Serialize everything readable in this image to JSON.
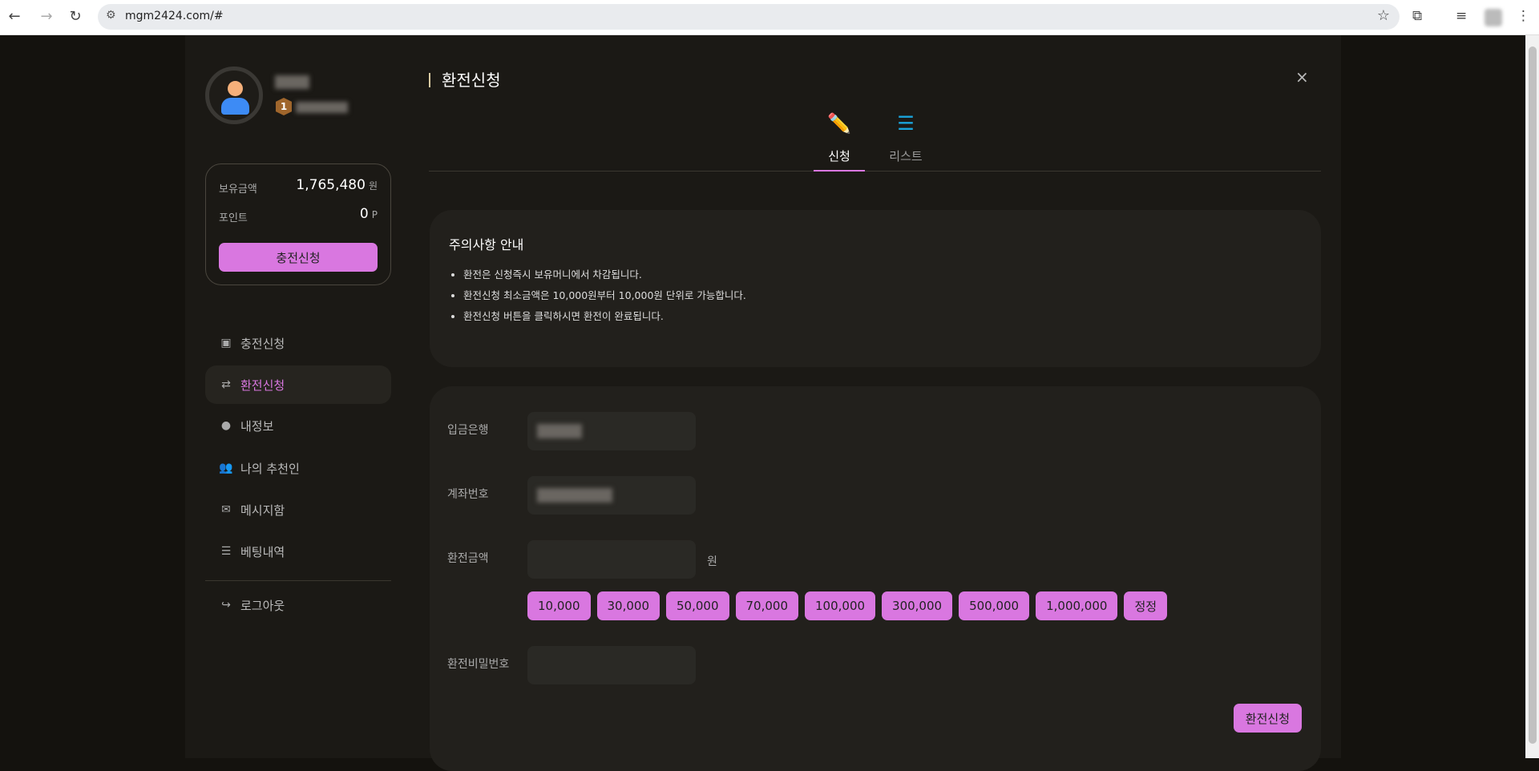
{
  "browser": {
    "url": "mgm2424.com/#"
  },
  "sidebar": {
    "balance_label": "보유금액",
    "balance_value": "1,765,480",
    "balance_unit": "원",
    "point_label": "포인트",
    "point_value": "0",
    "point_unit": "P",
    "charge_button": "충전신청",
    "level": "1",
    "menu": [
      {
        "label": "충전신청",
        "icon": "money-icon"
      },
      {
        "label": "환전신청",
        "icon": "exchange-icon"
      },
      {
        "label": "내정보",
        "icon": "user-circle-icon"
      },
      {
        "label": "나의 추천인",
        "icon": "users-icon"
      },
      {
        "label": "메시지함",
        "icon": "envelope-open-icon"
      },
      {
        "label": "베팅내역",
        "icon": "list-icon"
      }
    ],
    "logout": "로그아웃"
  },
  "main": {
    "title": "환전신청",
    "close": "×",
    "tabs": [
      {
        "label": "신청",
        "icon": "pencil-icon"
      },
      {
        "label": "리스트",
        "icon": "list-icon"
      }
    ],
    "notice": {
      "title": "주의사항 안내",
      "items": [
        "환전은 신청즉시 보유머니에서 차감됩니다.",
        "환전신청 최소금액은 10,000원부터 10,000원 단위로 가능합니다.",
        "환전신청 버튼을 클릭하시면 환전이 완료됩니다."
      ]
    },
    "form": {
      "bank_label": "입금은행",
      "account_label": "계좌번호",
      "amount_label": "환전금액",
      "amount_unit": "원",
      "password_label": "환전비밀번호",
      "amounts": [
        "10,000",
        "30,000",
        "50,000",
        "70,000",
        "100,000",
        "300,000",
        "500,000",
        "1,000,000",
        "정정"
      ],
      "submit": "환전신청"
    }
  },
  "colors": {
    "accent": "#d977e0",
    "bg": "#14120e",
    "panel": "#1b1915"
  }
}
